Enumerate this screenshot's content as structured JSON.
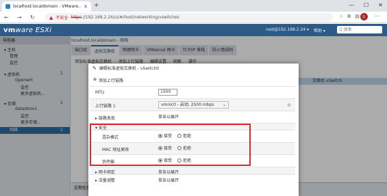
{
  "browser": {
    "tab_title": "localhost.localdomain - VMware...",
    "new_tab": "+",
    "window_controls": [
      "—",
      "☐",
      "✕"
    ],
    "security_warning": "不安全",
    "url_scheme": "https",
    "url_rest": "://192.168.2.24/ui/#/host/networking/vswitches",
    "profile_initial": "L"
  },
  "header": {
    "logo_main": "vm",
    "logo_rest": "ware ESXi",
    "user": "root@192.168.2.24 ▾",
    "help": "帮助 ▾",
    "search_placeholder": "Q 搜索"
  },
  "navigator": {
    "title": "导航器",
    "items": [
      {
        "label": "▾ 主机"
      },
      {
        "label": "管理"
      },
      {
        "label": "监控"
      },
      {
        "label": "▾ 虚拟机"
      },
      {
        "label": "Openwrt"
      },
      {
        "label": "监控"
      },
      {
        "label": "更多虚拟机..."
      },
      {
        "label": "▾ 存储"
      },
      {
        "label": "datastore1"
      },
      {
        "label": "监控"
      },
      {
        "label": "更多存储..."
      },
      {
        "label": "网络"
      }
    ],
    "badges": [
      "1",
      "1",
      "1"
    ]
  },
  "main": {
    "breadcrumb": "localhost.localdomain - 网络",
    "tabs": [
      "端口组",
      "虚拟交换机",
      "物理网卡",
      "VMkernel 网卡",
      "TCP/IP 堆栈",
      "防火墙规则"
    ],
    "toolbar": [
      "添加标准虚拟交换机",
      "添加上行链路",
      "编辑设置",
      "刷新",
      "操作"
    ],
    "selected_row_text": "交换机 vSwitch",
    "recent_tasks": "近期任务"
  },
  "dialog": {
    "title": "编辑标准虚拟交换机 - vSwitch0",
    "add_uplink": "添加上行链路",
    "rows": {
      "mtu_label": "MTU",
      "mtu_value": "1500",
      "uplink_label": "上行链路 1",
      "uplink_value": "vmnic0 - 启动, 2500 mbps",
      "link_discovery_label": "链路发现",
      "link_discovery_value": "单击以展开",
      "security_label": "安全",
      "promiscuous_label": "混杂模式",
      "mac_change_label": "MAC 地址更改",
      "forged_label": "伪传输",
      "accept": "接受",
      "reject": "拒绝",
      "nic_teaming_label": "网卡绑定",
      "nic_teaming_value": "单击以展开",
      "traffic_shaping_label": "流量调整",
      "traffic_shaping_value": "单击以展开"
    },
    "selections": {
      "promiscuous": "accept",
      "mac_change": "accept",
      "forged": "accept"
    }
  },
  "colors": {
    "brand": "#2d5a87",
    "highlight": "#d9262c",
    "selection": "#2d6ca2"
  }
}
